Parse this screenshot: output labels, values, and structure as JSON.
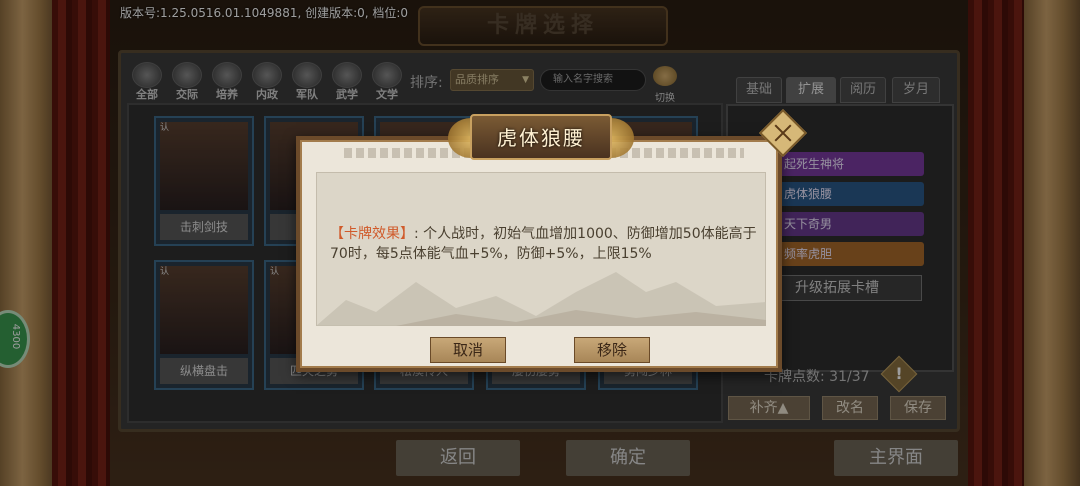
{
  "version_text": "版本号:1.25.0516.01.1049881, 创建版本:0, 档位:0",
  "screen_title": "卡牌选择",
  "categories": [
    "全部",
    "交际",
    "培养",
    "内政",
    "军队",
    "武学",
    "文学"
  ],
  "sort": {
    "label": "排序:",
    "selected": "品质排序"
  },
  "search": {
    "placeholder": "输入名字搜索"
  },
  "switch_label": "切换",
  "cards": [
    {
      "name": "击刺剑技",
      "badge": "认"
    },
    {
      "name": "",
      "badge": ""
    },
    {
      "name": "",
      "badge": ""
    },
    {
      "name": "",
      "badge": ""
    },
    {
      "name": "",
      "badge": ""
    },
    {
      "name": "纵横盘击",
      "badge": "认"
    },
    {
      "name": "匹夫之勇",
      "badge": "认"
    },
    {
      "name": "松溪传人",
      "badge": ""
    },
    {
      "name": "屡伤屡勇",
      "badge": ""
    },
    {
      "name": "勇闯少林",
      "badge": ""
    }
  ],
  "right_tabs": [
    "基础",
    "扩展",
    "阅历",
    "岁月"
  ],
  "skill_slots": [
    {
      "label": "起死生神将",
      "color": "#7a3aa0"
    },
    {
      "label": "虎体狼腰",
      "color": "#2a5a8a"
    },
    {
      "label": "天下奇男",
      "color": "#6a3a90"
    },
    {
      "label": "频率虎胆",
      "color": "#a86a2a"
    }
  ],
  "upgrade_slot_label": "升级拓展卡槽",
  "points_label": "卡牌点数: 31/37",
  "warn_symbol": "!",
  "right_buttons": {
    "reset": "补齐▲",
    "rename": "改名",
    "save": "保存"
  },
  "bottom_buttons": {
    "back": "返回",
    "confirm": "确定",
    "main": "主界面"
  },
  "side_badge": "4300",
  "modal": {
    "title": "虎体狼腰",
    "effect_key": "【卡牌效果】",
    "effect_text": ": 个人战时，初始气血增加1000、防御增加50体能高于70时，每5点体能气血+5%，防御+5%，上限15%",
    "cancel": "取消",
    "remove": "移除"
  }
}
